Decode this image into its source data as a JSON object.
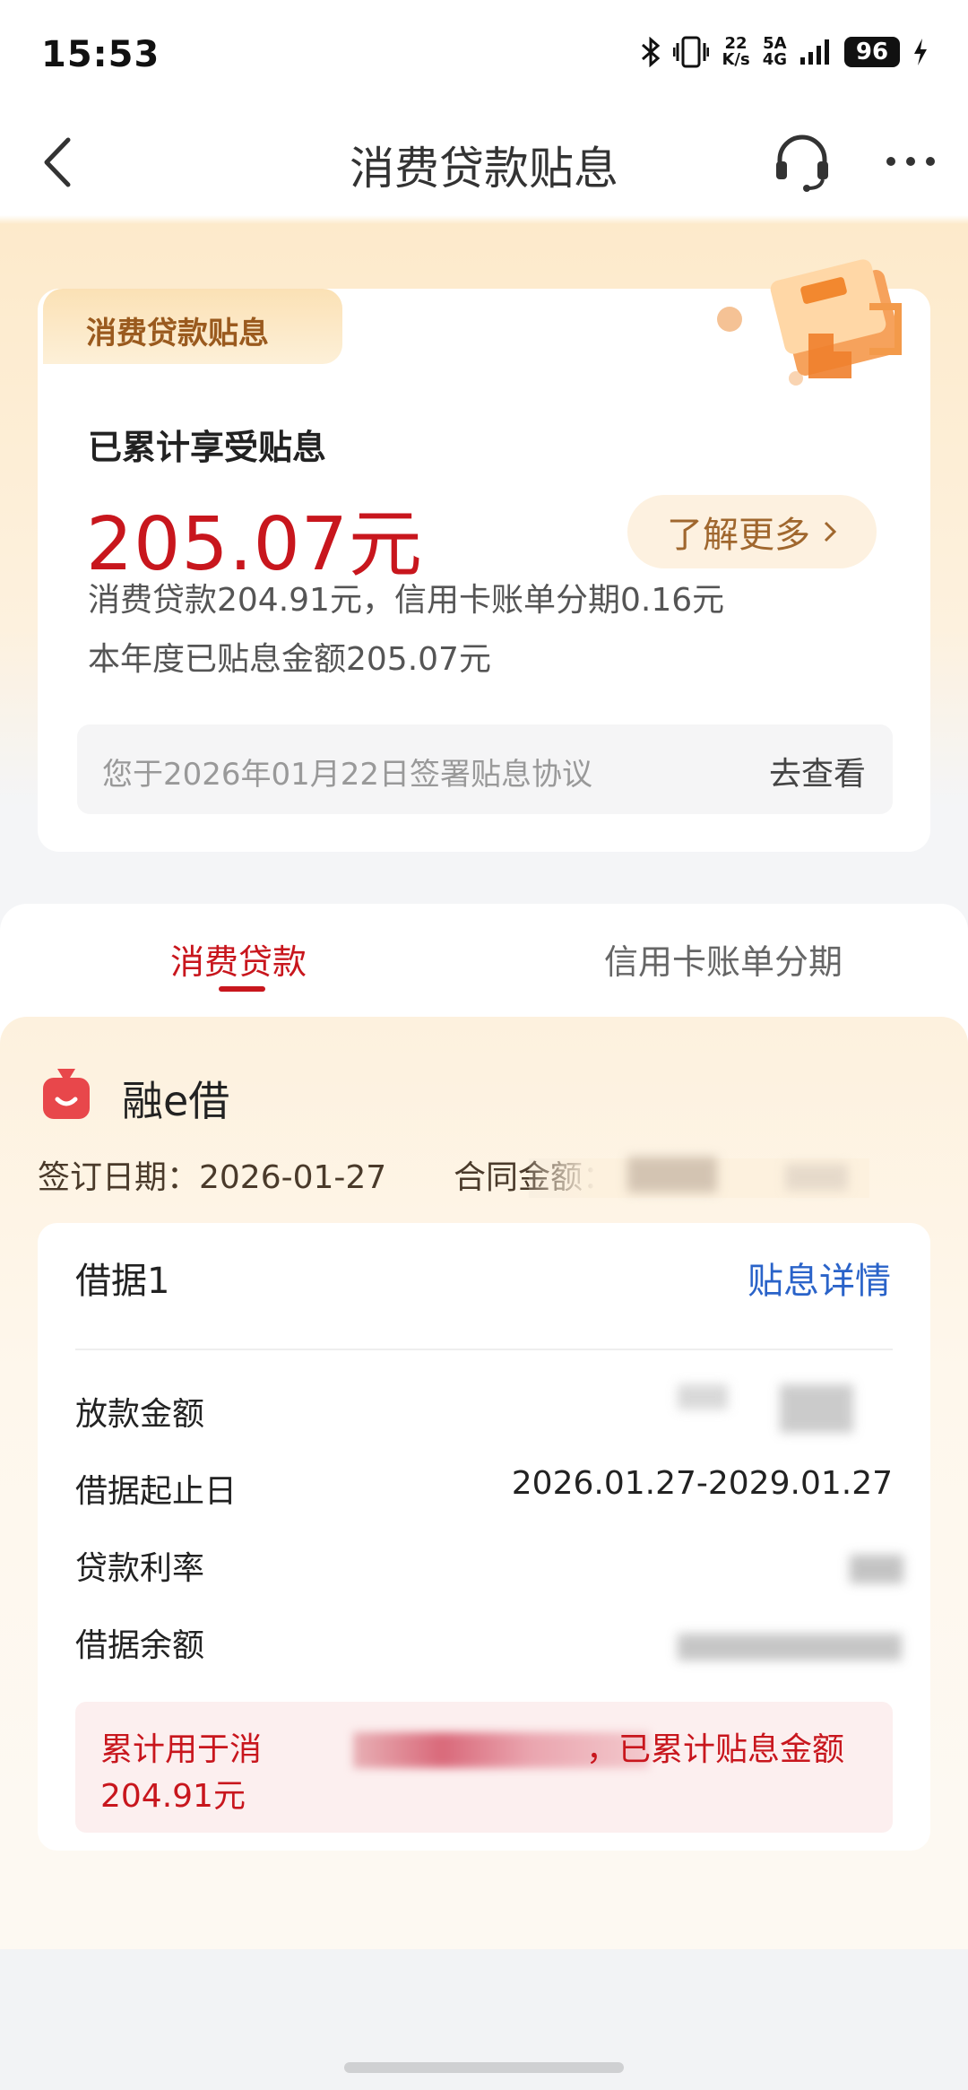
{
  "status_bar": {
    "time": "15:53",
    "net_speed_top": "22",
    "net_speed_bottom": "K/s",
    "signal_top": "5A",
    "signal_bottom": "4G",
    "battery": "96"
  },
  "nav": {
    "title": "消费贷款贴息",
    "back_icon": "chevron-left-icon",
    "service_icon": "headset-icon",
    "more_icon": "more-icon"
  },
  "summary": {
    "badge": "消费贷款贴息",
    "label": "已累计享受贴息",
    "amount": "205.07元",
    "more_button": "了解更多",
    "breakdown": "消费贷款204.91元，信用卡账单分期0.16元",
    "this_year": "本年度已贴息金额205.07元",
    "agreement_text": "您于2026年01月22日签署贴息协议",
    "agreement_link": "去查看"
  },
  "tabs": [
    {
      "label": "消费贷款",
      "active": true
    },
    {
      "label": "信用卡账单分期",
      "active": false
    }
  ],
  "loan": {
    "product_name": "融e借",
    "sign_date": "签订日期：2026-01-27",
    "contract_label": "合同金额："
  },
  "detail": {
    "title": "借据1",
    "link": "贴息详情",
    "rows": [
      {
        "label": "放款金额",
        "value": ""
      },
      {
        "label": "借据起止日",
        "value": "2026.01.27-2029.01.27"
      },
      {
        "label": "贷款利率",
        "value": ""
      },
      {
        "label": "借据余额",
        "value": ""
      }
    ],
    "notice_prefix": "累计用于消",
    "notice_suffix": "，已累计贴息金额",
    "notice_amount": "204.91元"
  },
  "colors": {
    "accent_red": "#c8161d",
    "link_blue": "#2a63c9",
    "gold": "#a0672e"
  }
}
